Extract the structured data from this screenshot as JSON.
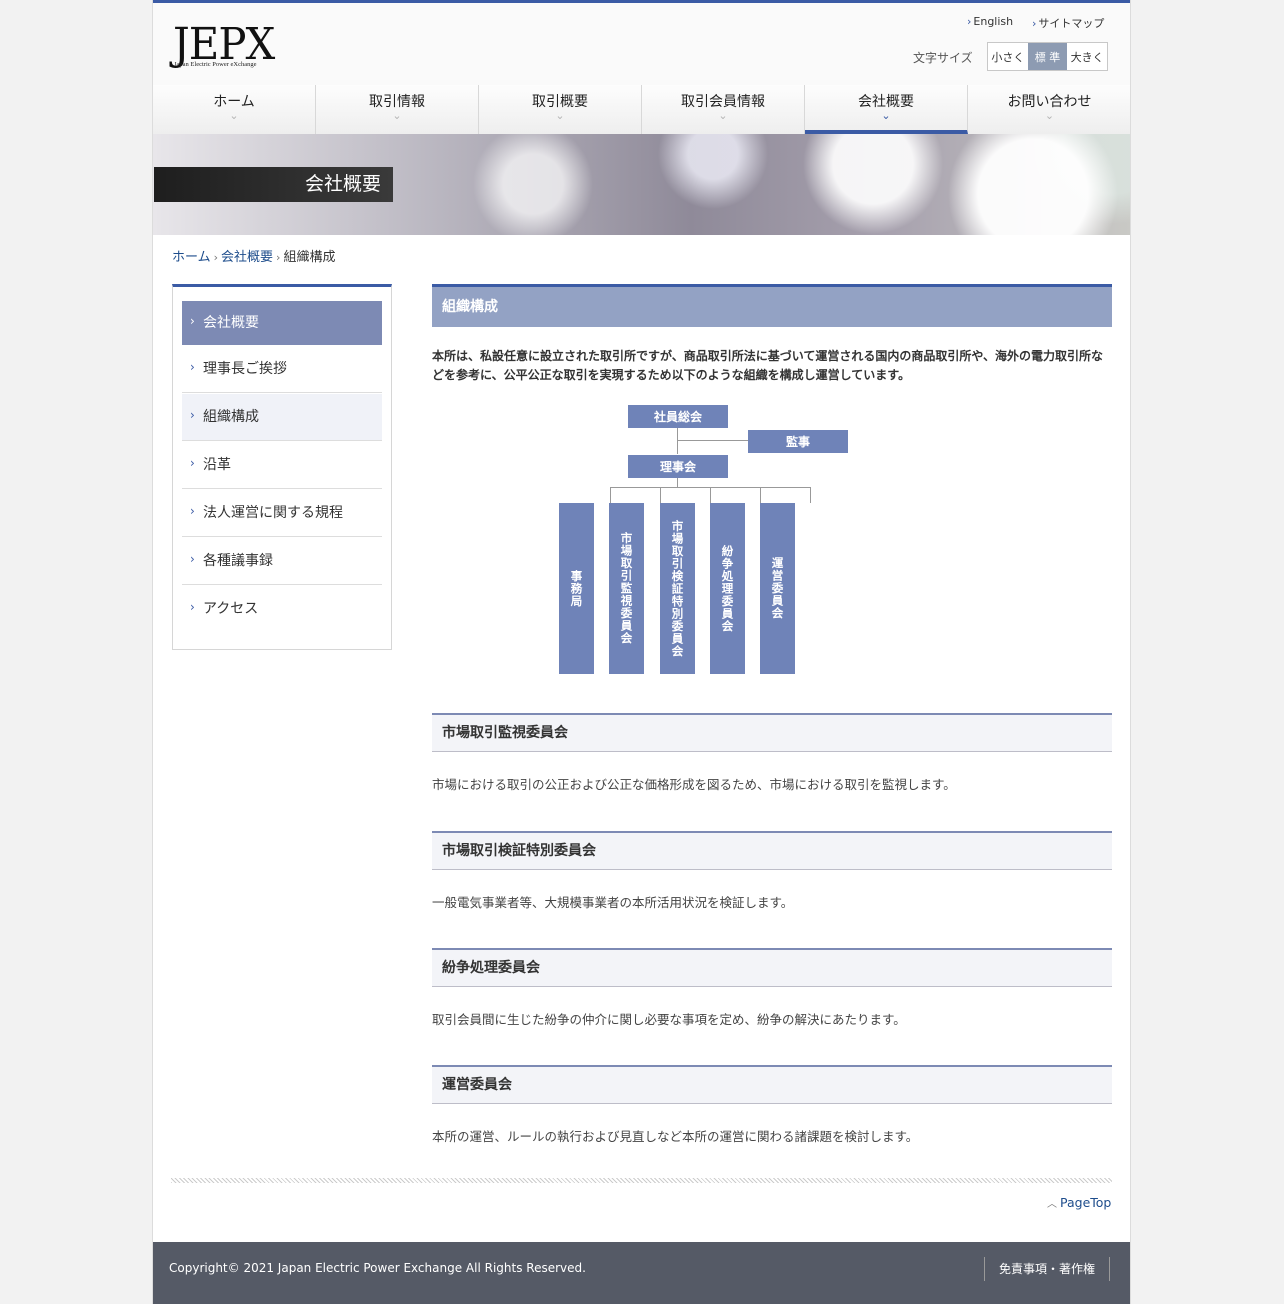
{
  "header": {
    "logo": "JEPX",
    "logo_sub": "Japan Electric Power eXchange",
    "util_english": "English",
    "util_sitemap": "サイトマップ",
    "font_size_label": "文字サイズ",
    "font_size_options": [
      "小さく",
      "標 準",
      "大きく"
    ],
    "font_size_selected": "標 準"
  },
  "gnav": [
    "ホーム",
    "取引情報",
    "取引概要",
    "取引会員情報",
    "会社概要",
    "お問い合わせ"
  ],
  "gnav_active": "会社概要",
  "hero": {
    "title": "会社概要"
  },
  "breadcrumb": [
    "ホーム",
    "会社概要",
    "組織構成"
  ],
  "sidebar": {
    "heading": "会社概要",
    "items": [
      "理事長ご挨拶",
      "組織構成",
      "沿革",
      "法人運営に関する規程",
      "各種議事録",
      "アクセス"
    ],
    "current": "組織構成"
  },
  "main": {
    "title": "組織構成",
    "intro": "本所は、私設任意に設立された取引所ですが、商品取引所法に基づいて運営される国内の商品取引所や、海外の電力取引所などを参考に、公平公正な取引を実現するため以下のような組織を構成し運営しています。",
    "org": {
      "general_meeting": "社員総会",
      "auditor": "監事",
      "board": "理事会",
      "committees": [
        "事務局",
        "市場取引監視委員会",
        "市場取引検証特別委員会",
        "紛争処理委員会",
        "運営委員会"
      ]
    },
    "sections": [
      {
        "title": "市場取引監視委員会",
        "text": "市場における取引の公正および公正な価格形成を図るため、市場における取引を監視します。"
      },
      {
        "title": "市場取引検証特別委員会",
        "text": "一般電気事業者等、大規模事業者の本所活用状況を検証します。"
      },
      {
        "title": "紛争処理委員会",
        "text": "取引会員間に生じた紛争の仲介に関し必要な事項を定め、紛争の解決にあたります。"
      },
      {
        "title": "運営委員会",
        "text": "本所の運営、ルールの執行および見直しなど本所の運営に関わる諸課題を検討します。"
      }
    ]
  },
  "pagetop": "PageTop",
  "footer": {
    "copyright": "Copyright© 2021 Japan Electric Power Exchange All Rights Reserved.",
    "link": "免責事項・著作権"
  },
  "colors": {
    "brand_blue": "#3b5ba5",
    "box_blue": "#6f83b8",
    "footer": "#555a66"
  }
}
